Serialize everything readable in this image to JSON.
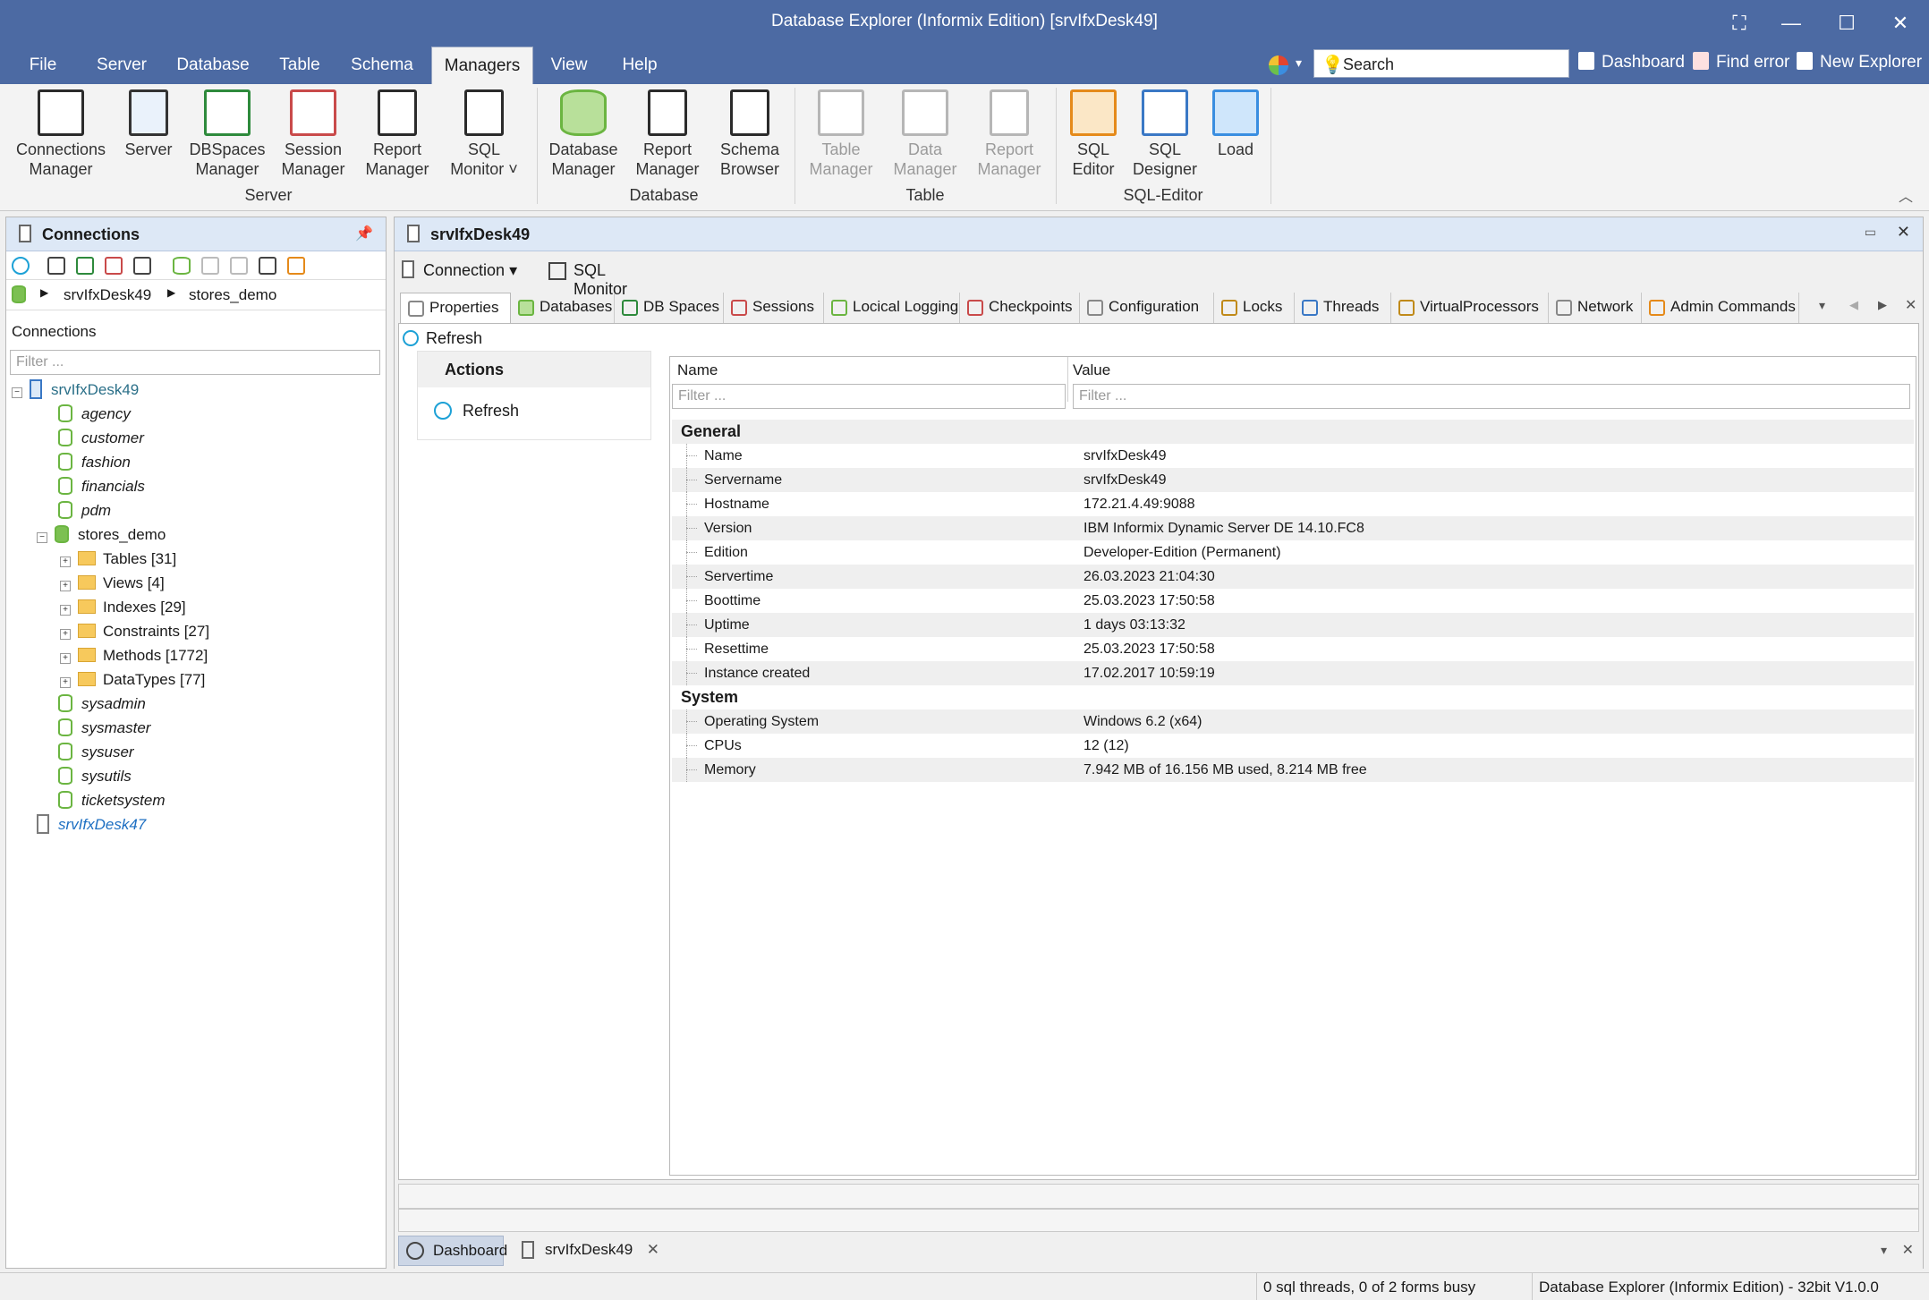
{
  "window": {
    "title": "Database Explorer (Informix Edition) [srvIfxDesk49]"
  },
  "menu": [
    "File",
    "Server",
    "Database",
    "Table",
    "Schema",
    "Managers",
    "View",
    "Help"
  ],
  "topbar": {
    "search_placeholder": "Search",
    "dashboard": "Dashboard",
    "find_error": "Find error",
    "new_explorer": "New Explorer"
  },
  "ribbon": {
    "server_group": "Server",
    "database_group": "Database",
    "table_group": "Table",
    "sqleditor_group": "SQL-Editor",
    "connections_manager": [
      "Connections",
      "Manager"
    ],
    "server": [
      "Server",
      ""
    ],
    "dbspaces_manager": [
      "DBSpaces",
      "Manager"
    ],
    "session_manager": [
      "Session",
      "Manager"
    ],
    "report_manager1": [
      "Report",
      "Manager"
    ],
    "sql_monitor": [
      "SQL",
      "Monitor"
    ],
    "database_manager": [
      "Database",
      "Manager"
    ],
    "report_manager2": [
      "Report",
      "Manager"
    ],
    "schema_browser": [
      "Schema",
      "Browser"
    ],
    "table_manager": [
      "Table",
      "Manager"
    ],
    "data_manager": [
      "Data",
      "Manager"
    ],
    "report_manager3": [
      "Report",
      "Manager"
    ],
    "sql_editor": [
      "SQL",
      "Editor"
    ],
    "sql_designer": [
      "SQL",
      "Designer"
    ],
    "load": [
      "Load",
      ""
    ]
  },
  "left": {
    "title": "Connections",
    "crumb1": "srvIfxDesk49",
    "crumb2": "stores_demo",
    "label": "Connections",
    "filter": "Filter ...",
    "tree": {
      "root": "srvIfxDesk49",
      "dbs": [
        "agency",
        "customer",
        "fashion",
        "financials",
        "pdm"
      ],
      "open_db": "stores_demo",
      "children": [
        "Tables [31]",
        "Views [4]",
        "Indexes [29]",
        "Constraints [27]",
        "Methods [1772]",
        "DataTypes [77]"
      ],
      "dbs2": [
        "sysadmin",
        "sysmaster",
        "sysuser",
        "sysutils",
        "ticketsystem"
      ],
      "other": "srvIfxDesk47"
    }
  },
  "main": {
    "title": "srvIfxDesk49",
    "connection": "Connection",
    "sql_monitor": "SQL Monitor",
    "tabs": [
      "Properties",
      "Databases",
      "DB Spaces",
      "Sessions",
      "Locical Logging",
      "Checkpoints",
      "Configuration",
      "Locks",
      "Threads",
      "VirtualProcessors",
      "Network",
      "Admin Commands"
    ],
    "refresh": "Refresh",
    "actions_title": "Actions",
    "actions_refresh": "Refresh",
    "col_name": "Name",
    "col_value": "Value",
    "filter": "Filter ...",
    "general": "General",
    "general_rows": [
      [
        "Name",
        "srvIfxDesk49"
      ],
      [
        "Servername",
        "srvIfxDesk49"
      ],
      [
        "Hostname",
        "172.21.4.49:9088"
      ],
      [
        "Version",
        "IBM Informix Dynamic Server DE 14.10.FC8"
      ],
      [
        "Edition",
        "Developer-Edition (Permanent)"
      ],
      [
        "Servertime",
        "26.03.2023 21:04:30"
      ],
      [
        "Boottime",
        "25.03.2023 17:50:58"
      ],
      [
        "Uptime",
        "1 days 03:13:32"
      ],
      [
        "Resettime",
        "25.03.2023 17:50:58"
      ],
      [
        "Instance created",
        "17.02.2017 10:59:19"
      ]
    ],
    "system": "System",
    "system_rows": [
      [
        "Operating System",
        "Windows 6.2 (x64)"
      ],
      [
        "CPUs",
        "12 (12)"
      ],
      [
        "Memory",
        "7.942 MB of 16.156 MB used, 8.214 MB free"
      ]
    ]
  },
  "doctabs": {
    "dashboard": "Dashboard",
    "server": "srvIfxDesk49"
  },
  "status": {
    "threads": "0 sql threads, 0 of 2 forms busy",
    "version": "Database Explorer (Informix Edition) - 32bit V1.0.0"
  }
}
